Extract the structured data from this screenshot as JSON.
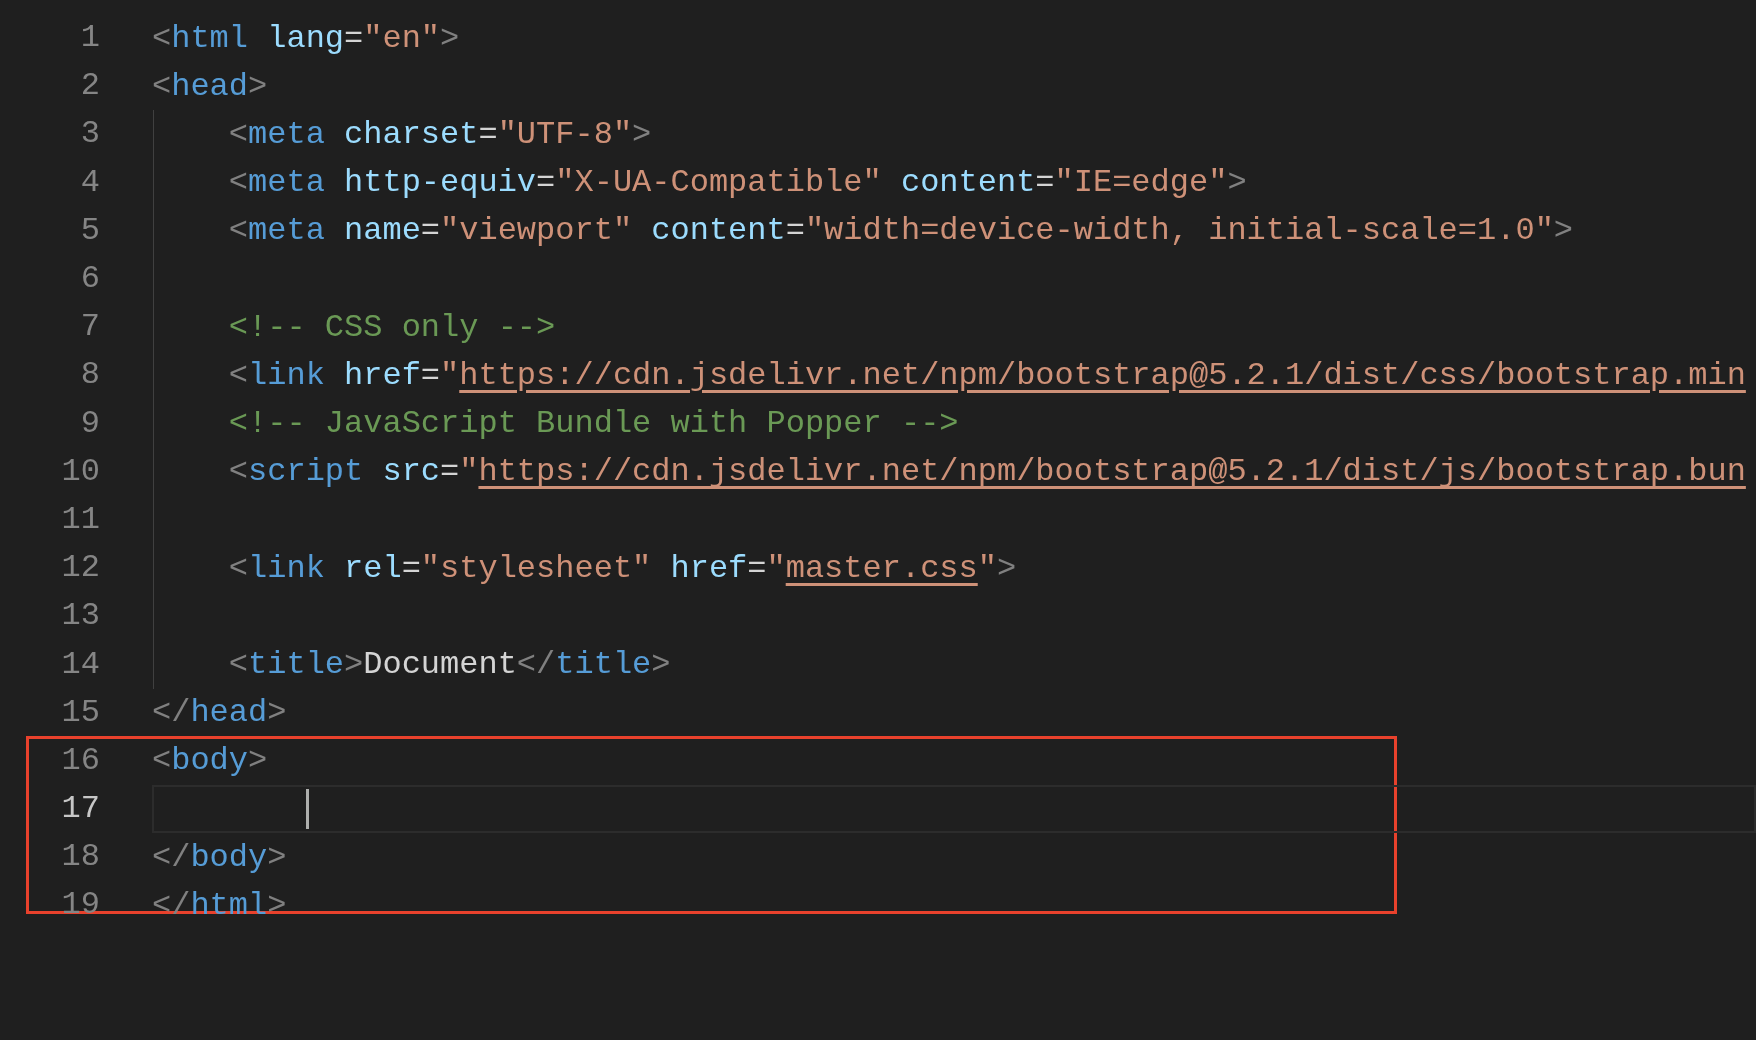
{
  "editor": {
    "lines": [
      {
        "number": "1",
        "current": false,
        "indent_guide": false,
        "tokens": [
          {
            "kind": "punct",
            "text": "<"
          },
          {
            "kind": "tag",
            "text": "html"
          },
          {
            "kind": "attr",
            "text": " lang"
          },
          {
            "kind": "text",
            "text": "="
          },
          {
            "kind": "string",
            "text": "\"en\""
          },
          {
            "kind": "punct",
            "text": ">"
          }
        ]
      },
      {
        "number": "2",
        "current": false,
        "indent_guide": false,
        "tokens": [
          {
            "kind": "punct",
            "text": "<"
          },
          {
            "kind": "tag",
            "text": "head"
          },
          {
            "kind": "punct",
            "text": ">"
          }
        ]
      },
      {
        "number": "3",
        "current": false,
        "indent_guide": true,
        "tokens": [
          {
            "kind": "punct",
            "text": "    <"
          },
          {
            "kind": "tag",
            "text": "meta"
          },
          {
            "kind": "attr",
            "text": " charset"
          },
          {
            "kind": "text",
            "text": "="
          },
          {
            "kind": "string",
            "text": "\"UTF-8\""
          },
          {
            "kind": "punct",
            "text": ">"
          }
        ]
      },
      {
        "number": "4",
        "current": false,
        "indent_guide": true,
        "tokens": [
          {
            "kind": "punct",
            "text": "    <"
          },
          {
            "kind": "tag",
            "text": "meta"
          },
          {
            "kind": "attr",
            "text": " http-equiv"
          },
          {
            "kind": "text",
            "text": "="
          },
          {
            "kind": "string",
            "text": "\"X-UA-Compatible\""
          },
          {
            "kind": "attr",
            "text": " content"
          },
          {
            "kind": "text",
            "text": "="
          },
          {
            "kind": "string",
            "text": "\"IE=edge\""
          },
          {
            "kind": "punct",
            "text": ">"
          }
        ]
      },
      {
        "number": "5",
        "current": false,
        "indent_guide": true,
        "tokens": [
          {
            "kind": "punct",
            "text": "    <"
          },
          {
            "kind": "tag",
            "text": "meta"
          },
          {
            "kind": "attr",
            "text": " name"
          },
          {
            "kind": "text",
            "text": "="
          },
          {
            "kind": "string",
            "text": "\"viewport\""
          },
          {
            "kind": "attr",
            "text": " content"
          },
          {
            "kind": "text",
            "text": "="
          },
          {
            "kind": "string",
            "text": "\"width=device-width, initial-scale=1.0\""
          },
          {
            "kind": "punct",
            "text": ">"
          }
        ]
      },
      {
        "number": "6",
        "current": false,
        "indent_guide": true
      },
      {
        "number": "7",
        "current": false,
        "indent_guide": true,
        "tokens": [
          {
            "kind": "comment",
            "text": "    <!-- CSS only -->"
          }
        ]
      },
      {
        "number": "8",
        "current": false,
        "indent_guide": true,
        "tokens": [
          {
            "kind": "punct",
            "text": "    <"
          },
          {
            "kind": "tag",
            "text": "link"
          },
          {
            "kind": "attr",
            "text": " href"
          },
          {
            "kind": "text",
            "text": "="
          },
          {
            "kind": "string",
            "text": "\""
          },
          {
            "kind": "link",
            "text": "https://cdn.jsdelivr.net/npm/bootstrap@5.2.1/dist/css/bootstrap.min"
          }
        ]
      },
      {
        "number": "9",
        "current": false,
        "indent_guide": true,
        "tokens": [
          {
            "kind": "comment",
            "text": "    <!-- JavaScript Bundle with Popper -->"
          }
        ]
      },
      {
        "number": "10",
        "current": false,
        "indent_guide": true,
        "tokens": [
          {
            "kind": "punct",
            "text": "    <"
          },
          {
            "kind": "tag",
            "text": "script"
          },
          {
            "kind": "attr",
            "text": " src"
          },
          {
            "kind": "text",
            "text": "="
          },
          {
            "kind": "string",
            "text": "\""
          },
          {
            "kind": "link",
            "text": "https://cdn.jsdelivr.net/npm/bootstrap@5.2.1/dist/js/bootstrap.bun"
          }
        ]
      },
      {
        "number": "11",
        "current": false,
        "indent_guide": true
      },
      {
        "number": "12",
        "current": false,
        "indent_guide": true,
        "tokens": [
          {
            "kind": "punct",
            "text": "    <"
          },
          {
            "kind": "tag",
            "text": "link"
          },
          {
            "kind": "attr",
            "text": " rel"
          },
          {
            "kind": "text",
            "text": "="
          },
          {
            "kind": "string",
            "text": "\"stylesheet\""
          },
          {
            "kind": "attr",
            "text": " href"
          },
          {
            "kind": "text",
            "text": "="
          },
          {
            "kind": "string",
            "text": "\""
          },
          {
            "kind": "link",
            "text": "master.css"
          },
          {
            "kind": "string",
            "text": "\""
          },
          {
            "kind": "punct",
            "text": ">"
          }
        ]
      },
      {
        "number": "13",
        "current": false,
        "indent_guide": true
      },
      {
        "number": "14",
        "current": false,
        "indent_guide": true,
        "tokens": [
          {
            "kind": "punct",
            "text": "    <"
          },
          {
            "kind": "tag",
            "text": "title"
          },
          {
            "kind": "punct",
            "text": ">"
          },
          {
            "kind": "text",
            "text": "Document"
          },
          {
            "kind": "punct",
            "text": "</"
          },
          {
            "kind": "tag",
            "text": "title"
          },
          {
            "kind": "punct",
            "text": ">"
          }
        ]
      },
      {
        "number": "15",
        "current": false,
        "indent_guide": false,
        "tokens": [
          {
            "kind": "punct",
            "text": "</"
          },
          {
            "kind": "tag",
            "text": "head"
          },
          {
            "kind": "punct",
            "text": ">"
          }
        ]
      },
      {
        "number": "16",
        "current": false,
        "indent_guide": false,
        "tokens": [
          {
            "kind": "punct",
            "text": "<"
          },
          {
            "kind": "tag",
            "text": "body"
          },
          {
            "kind": "punct",
            "text": ">"
          }
        ]
      },
      {
        "number": "17",
        "current": true,
        "indent_guide": false
      },
      {
        "number": "18",
        "current": false,
        "indent_guide": false,
        "tokens": [
          {
            "kind": "punct",
            "text": "</"
          },
          {
            "kind": "tag",
            "text": "body"
          },
          {
            "kind": "punct",
            "text": ">"
          }
        ]
      },
      {
        "number": "19",
        "current": false,
        "indent_guide": false,
        "tokens": [
          {
            "kind": "punct",
            "text": "</"
          },
          {
            "kind": "tag",
            "text": "html"
          },
          {
            "kind": "punct",
            "text": ">"
          }
        ]
      }
    ]
  }
}
